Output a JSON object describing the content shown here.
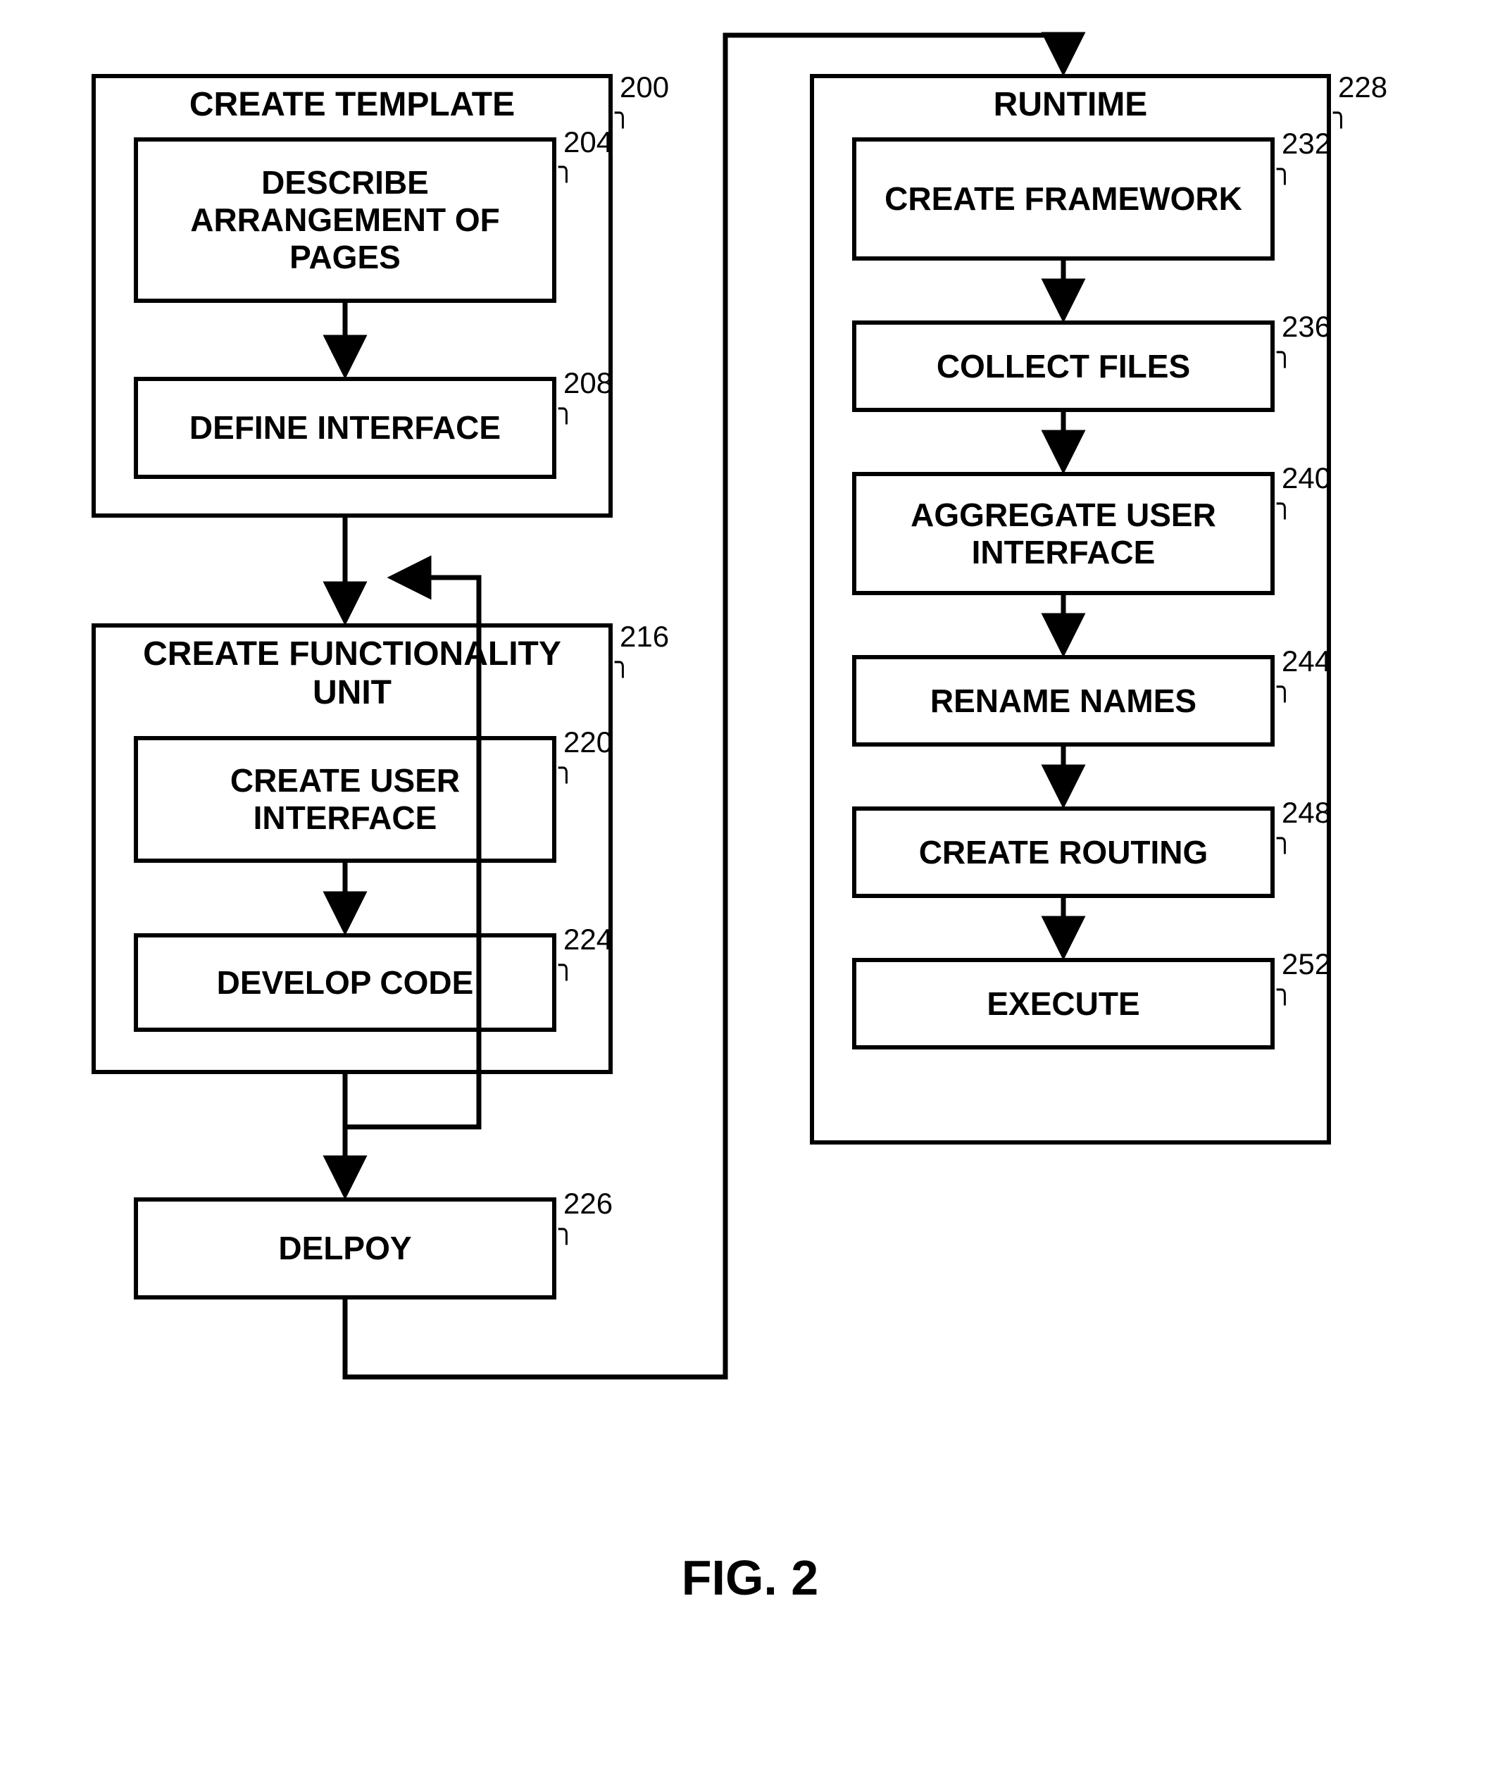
{
  "figure_caption": "FIG. 2",
  "left": {
    "outer1": {
      "title": "CREATE TEMPLATE",
      "num": "200",
      "step1": {
        "label": "DESCRIBE ARRANGEMENT OF PAGES",
        "num": "204"
      },
      "step2": {
        "label": "DEFINE INTERFACE",
        "num": "208"
      }
    },
    "outer2": {
      "title": "CREATE FUNCTIONALITY UNIT",
      "num": "216",
      "step1": {
        "label": "CREATE USER INTERFACE",
        "num": "220"
      },
      "step2": {
        "label": "DEVELOP CODE",
        "num": "224"
      }
    },
    "deploy": {
      "label": "DELPOY",
      "num": "226"
    }
  },
  "right": {
    "outer": {
      "title": "RUNTIME",
      "num": "228",
      "s1": {
        "label": "CREATE FRAMEWORK",
        "num": "232"
      },
      "s2": {
        "label": "COLLECT FILES",
        "num": "236"
      },
      "s3": {
        "label": "AGGREGATE USER INTERFACE",
        "num": "240"
      },
      "s4": {
        "label": "RENAME NAMES",
        "num": "244"
      },
      "s5": {
        "label": "CREATE ROUTING",
        "num": "248"
      },
      "s6": {
        "label": "EXECUTE",
        "num": "252"
      }
    }
  }
}
